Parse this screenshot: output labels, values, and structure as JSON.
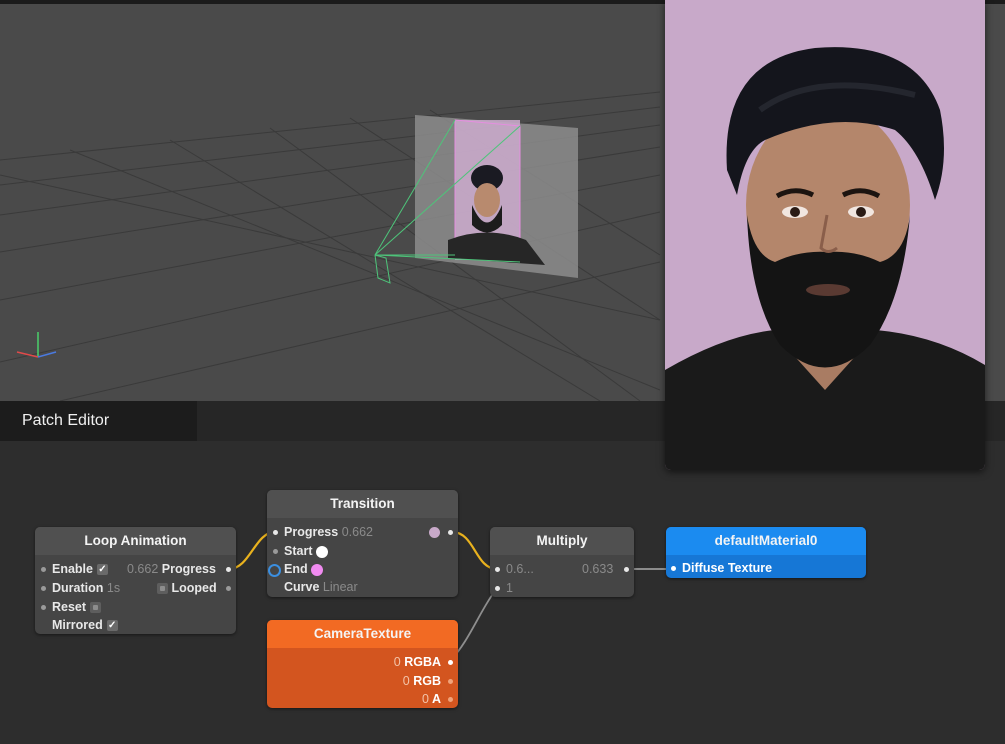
{
  "panel": {
    "title": "Patch Editor"
  },
  "colors": {
    "wire_orange": "#e9b21e",
    "wire_gray": "#9a9a9a",
    "camera_texture": "#f26a23",
    "material": "#1b8bf0",
    "preview_bg": "#c8a9c9",
    "start_color": "#ffffff",
    "end_color": "#f08bf0"
  },
  "nodes": {
    "loop_animation": {
      "title": "Loop Animation",
      "enable_label": "Enable",
      "enable_check": "✓",
      "duration_label": "Duration",
      "duration_value": "1s",
      "reset_label": "Reset",
      "mirrored_label": "Mirrored",
      "mirrored_check": "✓",
      "progress_value": "0.662",
      "progress_label": "Progress",
      "looped_label": "Looped"
    },
    "transition": {
      "title": "Transition",
      "progress_label": "Progress",
      "progress_value": "0.662",
      "start_label": "Start",
      "end_label": "End",
      "curve_label": "Curve",
      "curve_value": "Linear"
    },
    "multiply": {
      "title": "Multiply",
      "input1_value": "0.6...",
      "output_value": "0.633",
      "input2_value": "1"
    },
    "default_material": {
      "title": "defaultMaterial0",
      "diffuse_label": "Diffuse Texture"
    },
    "camera_texture": {
      "title": "CameraTexture",
      "rgba_value": "0",
      "rgba_label": "RGBA",
      "rgb_value": "0",
      "rgb_label": "RGB",
      "a_value": "0",
      "a_label": "A"
    }
  }
}
